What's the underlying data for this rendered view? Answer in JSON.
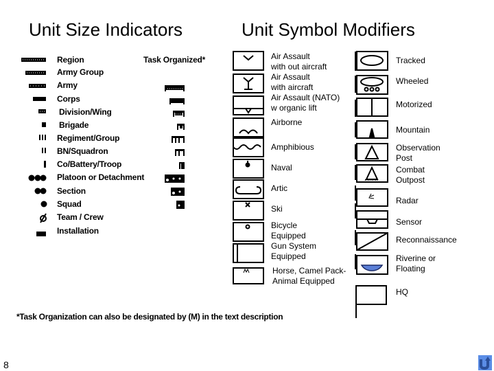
{
  "titles": {
    "left": "Unit Size Indicators",
    "right": "Unit Symbol Modifiers"
  },
  "size_indicators": {
    "task_organized_header": "Task Organized*",
    "items": [
      {
        "label": "Region",
        "icon": "region-icon"
      },
      {
        "label": "Army Group",
        "icon": "army-group-icon"
      },
      {
        "label": "Army",
        "icon": "army-icon"
      },
      {
        "label": "Corps",
        "icon": "corps-icon"
      },
      {
        "label": "Division/Wing",
        "icon": "division-icon"
      },
      {
        "label": "Brigade",
        "icon": "brigade-icon"
      },
      {
        "label": "Regiment/Group",
        "icon": "regiment-icon"
      },
      {
        "label": "BN/Squadron",
        "icon": "battalion-icon"
      },
      {
        "label": "Co/Battery/Troop",
        "icon": "company-icon"
      },
      {
        "label": "Platoon or Detachment",
        "icon": "platoon-icon"
      },
      {
        "label": "Section",
        "icon": "section-icon"
      },
      {
        "label": "Squad",
        "icon": "squad-icon"
      },
      {
        "label": "Team / Crew",
        "icon": "team-icon"
      },
      {
        "label": "Installation",
        "icon": "installation-icon"
      }
    ]
  },
  "modifiers_mid": [
    {
      "label": "Air Assault\nwith out aircraft",
      "icon": "air-assault-without-aircraft-icon"
    },
    {
      "label": "Air Assault\nwith aircraft",
      "icon": "air-assault-with-aircraft-icon"
    },
    {
      "label": "Air Assault (NATO)\nw organic lift",
      "icon": "air-assault-nato-icon"
    },
    {
      "label": "Airborne",
      "icon": "airborne-icon"
    },
    {
      "label": "Amphibious",
      "icon": "amphibious-icon"
    },
    {
      "label": "Naval",
      "icon": "naval-icon"
    },
    {
      "label": "Artic",
      "icon": "arctic-icon"
    },
    {
      "label": "Ski",
      "icon": "ski-icon"
    },
    {
      "label": "Bicycle\nEquipped",
      "icon": "bicycle-icon"
    },
    {
      "label": "Gun System\nEquipped",
      "icon": "gun-system-icon"
    },
    {
      "label": "Horse, Camel Pack-\nAnimal Equipped",
      "icon": "pack-animal-icon"
    }
  ],
  "modifiers_right": [
    {
      "label": "Tracked",
      "icon": "tracked-icon"
    },
    {
      "label": "Wheeled",
      "icon": "wheeled-icon"
    },
    {
      "label": "Motorized",
      "icon": "motorized-icon"
    },
    {
      "label": "Mountain",
      "icon": "mountain-icon"
    },
    {
      "label": "Observation\nPost",
      "icon": "observation-post-icon"
    },
    {
      "label": "Combat\nOutpost",
      "icon": "combat-outpost-icon"
    },
    {
      "label": "Radar",
      "icon": "radar-icon"
    },
    {
      "label": "Sensor",
      "icon": "sensor-icon"
    },
    {
      "label": "Reconnaissance",
      "icon": "reconnaissance-icon"
    },
    {
      "label": "Riverine or\nFloating",
      "icon": "riverine-icon"
    },
    {
      "label": "HQ",
      "icon": "hq-icon"
    }
  ],
  "footnote": "*Task Organization can also be designated by (M) in the text description",
  "page_number": "8",
  "nav": {
    "icon": "return-arrow-icon"
  },
  "colors": {
    "riverine_fill": "#5b7fd6",
    "nav_button": "#5b8de6",
    "nav_arrow": "#2a4f9a"
  }
}
